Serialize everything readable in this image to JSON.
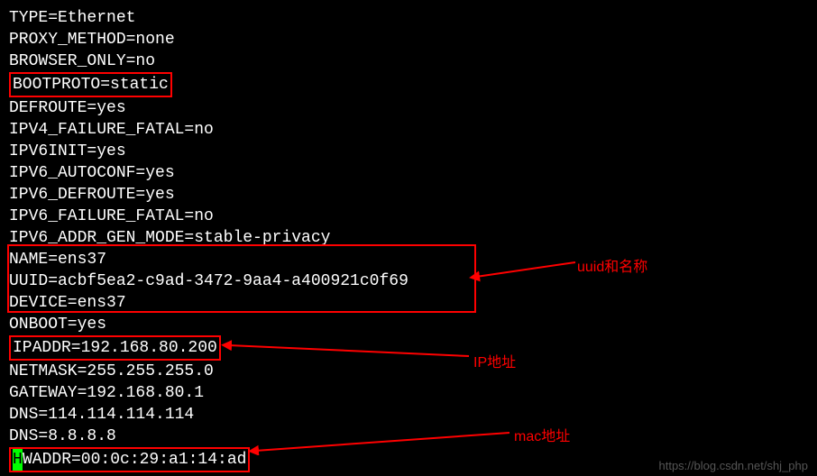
{
  "config": {
    "lines": [
      "TYPE=Ethernet",
      "PROXY_METHOD=none",
      "BROWSER_ONLY=no",
      "BOOTPROTO=static",
      "DEFROUTE=yes",
      "IPV4_FAILURE_FATAL=no",
      "IPV6INIT=yes",
      "IPV6_AUTOCONF=yes",
      "IPV6_DEFROUTE=yes",
      "IPV6_FAILURE_FATAL=no",
      "IPV6_ADDR_GEN_MODE=stable-privacy",
      "NAME=ens37",
      "UUID=acbf5ea2-c9ad-3472-9aa4-a400921c0f69",
      "DEVICE=ens37",
      "ONBOOT=yes",
      "IPADDR=192.168.80.200",
      "NETMASK=255.255.255.0",
      "GATEWAY=192.168.80.1",
      "DNS=114.114.114.114",
      "DNS=8.8.8.8",
      "HWADDR=00:0c:29:a1:14:ad"
    ],
    "hwaddr_first": "H",
    "hwaddr_rest": "WADDR=00:0c:29:a1:14:ad"
  },
  "annotations": {
    "uuid": "uuid和名称",
    "ip": "IP地址",
    "mac": "mac地址"
  },
  "watermark": "https://blog.csdn.net/shj_php"
}
